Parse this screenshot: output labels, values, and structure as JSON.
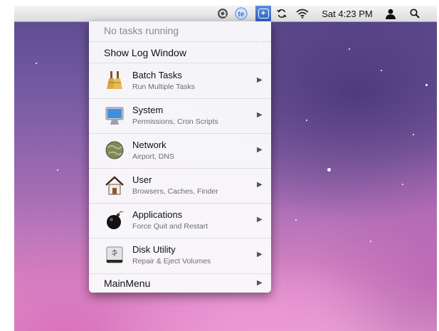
{
  "menubar": {
    "clock": "Sat 4:23 PM"
  },
  "menu": {
    "status": "No tasks running",
    "show_log": "Show Log Window",
    "items": [
      {
        "title": "Batch Tasks",
        "subtitle": "Run Multiple Tasks",
        "icon": "broom-icon"
      },
      {
        "title": "System",
        "subtitle": "Permissions, Cron Scripts",
        "icon": "monitor-icon"
      },
      {
        "title": "Network",
        "subtitle": "Airport, DNS",
        "icon": "globe-icon"
      },
      {
        "title": "User",
        "subtitle": "Browsers, Caches, Finder",
        "icon": "house-icon"
      },
      {
        "title": "Applications",
        "subtitle": "Force Quit and Restart",
        "icon": "bomb-icon"
      },
      {
        "title": "Disk Utility",
        "subtitle": "Repair & Eject Volumes",
        "icon": "disk-icon"
      }
    ],
    "main_menu": "MainMenu"
  },
  "colors": {
    "menubar_active": "#3c6fd3",
    "menu_bg": "#fafafc"
  }
}
